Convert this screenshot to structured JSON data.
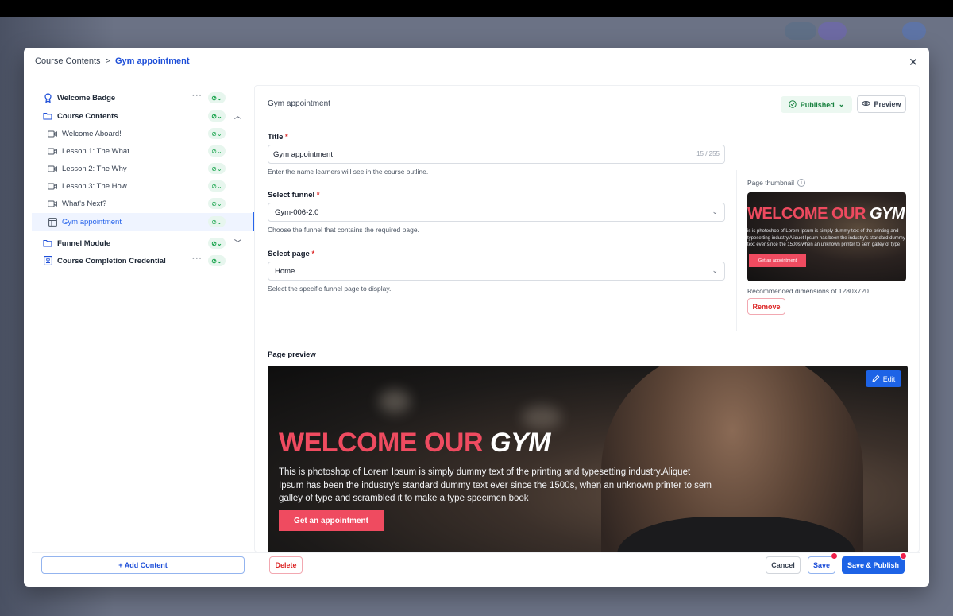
{
  "breadcrumb": {
    "parent": "Course Contents",
    "separator": ">",
    "current": "Gym appointment"
  },
  "sidebar": {
    "items": [
      {
        "label": "Welcome Badge",
        "level": "top",
        "icon": "badge-icon"
      },
      {
        "label": "Course Contents",
        "level": "top",
        "icon": "folder-icon"
      },
      {
        "label": "Welcome Aboard!",
        "level": "child",
        "icon": "video-icon"
      },
      {
        "label": "Lesson 1: The What",
        "level": "child",
        "icon": "video-icon"
      },
      {
        "label": "Lesson 2: The Why",
        "level": "child",
        "icon": "video-icon"
      },
      {
        "label": "Lesson 3: The How",
        "level": "child",
        "icon": "video-icon"
      },
      {
        "label": "What's Next?",
        "level": "child",
        "icon": "video-icon"
      },
      {
        "label": "Gym appointment",
        "level": "child",
        "icon": "page-icon",
        "active": true
      },
      {
        "label": "Funnel Module",
        "level": "top",
        "icon": "folder-icon"
      },
      {
        "label": "Course Completion Credential",
        "level": "top",
        "icon": "certificate-icon"
      }
    ],
    "add_content_label": "+ Add Content"
  },
  "panel": {
    "title": "Gym appointment",
    "status_label": "Published",
    "preview_label": "Preview"
  },
  "form": {
    "title_label": "Title",
    "title_value": "Gym appointment",
    "title_counter": "15 / 255",
    "title_help": "Enter the name learners will see in the course outline.",
    "funnel_label": "Select funnel",
    "funnel_value": "Gym-006-2.0",
    "funnel_help": "Choose the funnel that contains the required page.",
    "page_label": "Select page",
    "page_value": "Home",
    "page_help": "Select the specific funnel page to display.",
    "required_mark": "*"
  },
  "thumbnail": {
    "label": "Page thumbnail",
    "recommended": "Recommended dimensions of 1280×720",
    "remove_label": "Remove"
  },
  "preview": {
    "label": "Page preview",
    "headline_part1": "WELCOME OUR",
    "headline_part2": "GYM",
    "body": "This is photoshop of Lorem Ipsum is simply dummy text of the printing and typesetting industry.Aliquet Ipsum has been the industry's standard dummy text ever since the 1500s, when an unknown printer to sem galley of type and scrambled it to make a type specimen book",
    "cta": "Get an appointment",
    "edit_label": "Edit",
    "thumb_body": "is is photoshop of Lorem Ipsum is simply dummy text of the printing and typesetting industry.Aliquet Ipsum has been the industry's standard dummy text ever since the 1500s when an unknown printer to sem galley of type and scrambled it to make a type specimen book",
    "thumb_cta": "Get an appointment"
  },
  "footer": {
    "delete_label": "Delete",
    "cancel_label": "Cancel",
    "save_label": "Save",
    "save_publish_label": "Save & Publish"
  },
  "colors": {
    "accent": "#1d63e6",
    "success": "#16a34a",
    "danger": "#dc2626",
    "brand_pink": "#ef4b60"
  }
}
